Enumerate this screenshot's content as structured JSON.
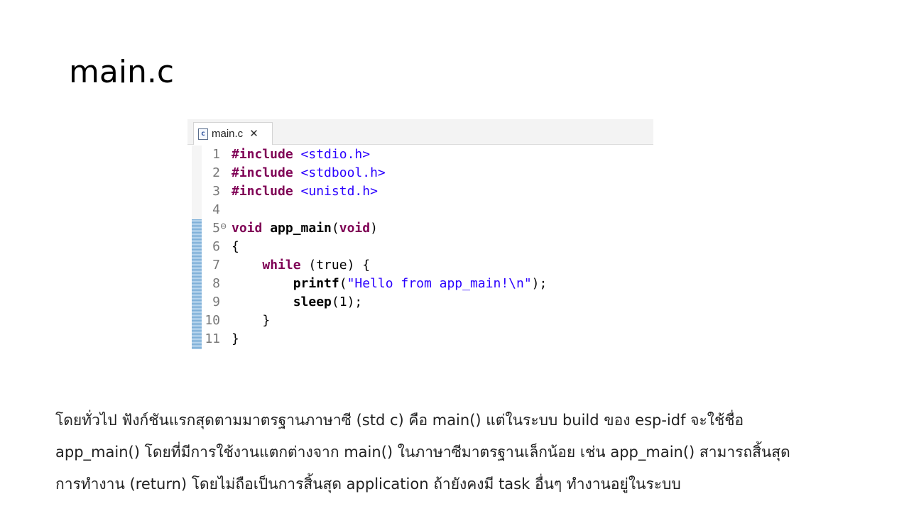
{
  "slide": {
    "title": "main.c"
  },
  "editor": {
    "tab": {
      "icon": "c-source-file-icon",
      "label": "main.c",
      "close_glyph": "✕"
    },
    "colors": {
      "keyword": "#7f0055",
      "string": "#2a00ff",
      "line_number": "#787878"
    },
    "lines": [
      {
        "num": "1",
        "tokens": [
          {
            "t": "#include",
            "c": "kw"
          },
          {
            "t": " ",
            "c": "plain"
          },
          {
            "t": "<stdio.h>",
            "c": "inc"
          }
        ]
      },
      {
        "num": "2",
        "tokens": [
          {
            "t": "#include",
            "c": "kw"
          },
          {
            "t": " ",
            "c": "plain"
          },
          {
            "t": "<stdbool.h>",
            "c": "inc"
          }
        ]
      },
      {
        "num": "3",
        "tokens": [
          {
            "t": "#include",
            "c": "kw"
          },
          {
            "t": " ",
            "c": "plain"
          },
          {
            "t": "<unistd.h>",
            "c": "inc"
          }
        ]
      },
      {
        "num": "4",
        "tokens": []
      },
      {
        "num": "5",
        "fold": true,
        "tokens": [
          {
            "t": "void",
            "c": "kw"
          },
          {
            "t": " ",
            "c": "plain"
          },
          {
            "t": "app_main",
            "c": "fn"
          },
          {
            "t": "(",
            "c": "plain"
          },
          {
            "t": "void",
            "c": "kw"
          },
          {
            "t": ")",
            "c": "plain"
          }
        ]
      },
      {
        "num": "6",
        "tokens": [
          {
            "t": "{",
            "c": "plain"
          }
        ]
      },
      {
        "num": "7",
        "tokens": [
          {
            "t": "    ",
            "c": "plain"
          },
          {
            "t": "while",
            "c": "kw"
          },
          {
            "t": " (true) {",
            "c": "plain"
          }
        ]
      },
      {
        "num": "8",
        "tokens": [
          {
            "t": "        ",
            "c": "plain"
          },
          {
            "t": "printf",
            "c": "fn"
          },
          {
            "t": "(",
            "c": "plain"
          },
          {
            "t": "\"Hello from app_main!\\n\"",
            "c": "str"
          },
          {
            "t": ");",
            "c": "plain"
          }
        ]
      },
      {
        "num": "9",
        "tokens": [
          {
            "t": "        ",
            "c": "plain"
          },
          {
            "t": "sleep",
            "c": "fn"
          },
          {
            "t": "(1);",
            "c": "plain"
          }
        ]
      },
      {
        "num": "10",
        "tokens": [
          {
            "t": "    }",
            "c": "plain"
          }
        ]
      },
      {
        "num": "11",
        "tokens": [
          {
            "t": "}",
            "c": "plain"
          }
        ]
      }
    ]
  },
  "description": {
    "lines": [
      "โดยทั่วไป ฟังก์ชันแรกสุดตามมาตรฐานภาษาซี (std c) คือ main() แต่ในระบบ build ของ esp-idf จะใช้ชื่อ",
      "app_main() โดยที่มีการใช้งานแตกต่างจาก main() ในภาษาซีมาตรฐานเล็กน้อย เช่น app_main() สามารถสิ้นสุด",
      "การทำงาน (return) โดยไม่ถือเป็นการสิ้นสุด application ถ้ายังคงมี task อื่นๆ ทำงานอยู่ในระบบ"
    ]
  }
}
